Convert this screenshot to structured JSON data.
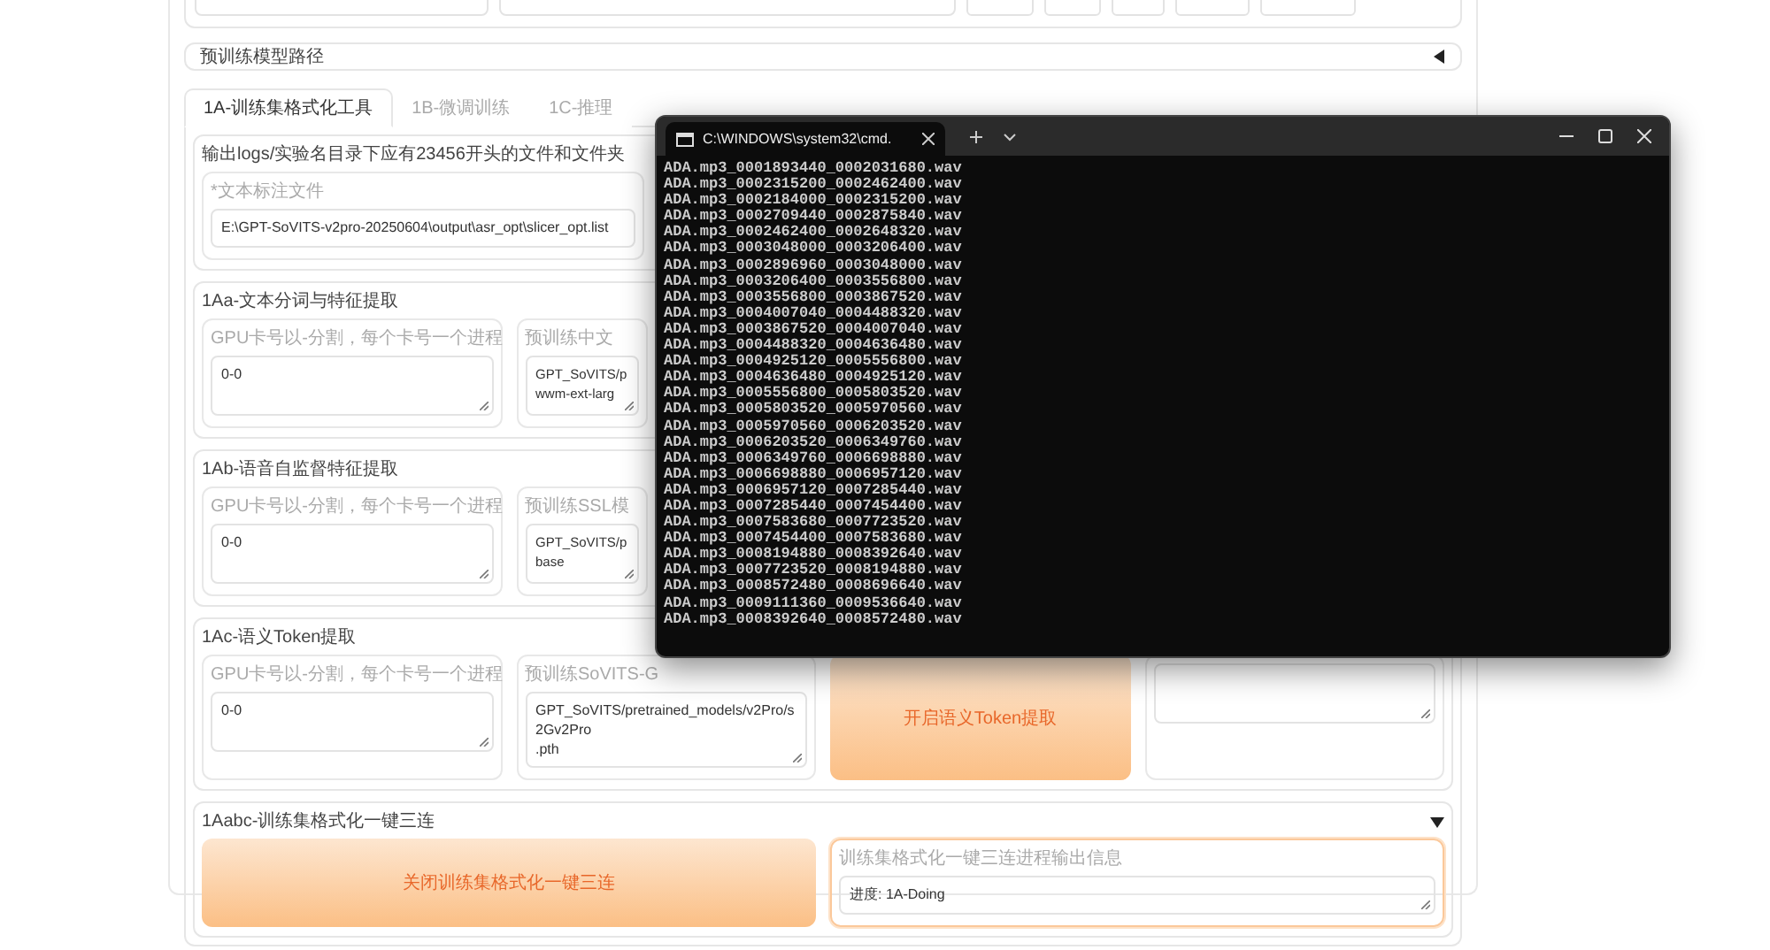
{
  "pretrained_accordion": {
    "label": "预训练模型路径",
    "expanded": false
  },
  "tabs": [
    {
      "label": "1A-训练集格式化工具",
      "selected": true
    },
    {
      "label": "1B-微调训练",
      "selected": false
    },
    {
      "label": "1C-推理",
      "selected": false
    }
  ],
  "intro": {
    "note": "输出logs/实验名目录下应有23456开头的文件和文件夹",
    "field": {
      "label": "*文本标注文件",
      "value": "E:\\GPT-SoVITS-v2pro-20250604\\output\\asr_opt\\slicer_opt.list"
    }
  },
  "sections": [
    {
      "title": "1Aa-文本分词与特征提取",
      "items": [
        {
          "kind": "field",
          "label": "GPU卡号以-分割，每个卡号一个进程",
          "value": "0-0"
        },
        {
          "kind": "field",
          "label": "预训练中文",
          "value": "GPT_SoVITS/p\nwwm-ext-larg"
        }
      ]
    },
    {
      "title": "1Ab-语音自监督特征提取",
      "items": [
        {
          "kind": "field",
          "label": "GPU卡号以-分割，每个卡号一个进程",
          "value": "0-0"
        },
        {
          "kind": "field",
          "label": "预训练SSL模",
          "value": "GPT_SoVITS/p\nbase"
        }
      ]
    },
    {
      "title": "1Ac-语义Token提取",
      "items": [
        {
          "kind": "field",
          "label": "GPU卡号以-分割，每个卡号一个进程",
          "value": "0-0"
        },
        {
          "kind": "field",
          "label": "预训练SoVITS-G",
          "value": "GPT_SoVITS/pretrained_models/v2Pro/s2Gv2Pro\n.pth"
        },
        {
          "kind": "button",
          "label": "开启语义Token提取"
        },
        {
          "kind": "field"
        }
      ]
    }
  ],
  "oneclick": {
    "title": "1Aabc-训练集格式化一键三连",
    "expanded": true,
    "button": "关闭训练集格式化一键三连",
    "output": {
      "label": "训练集格式化一键三连进程输出信息",
      "value": "进度: 1A-Doing"
    }
  },
  "terminal": {
    "tab_title": "C:\\WINDOWS\\system32\\cmd.",
    "lines": [
      "ADA.mp3_0001893440_0002031680.wav",
      "ADA.mp3_0002315200_0002462400.wav",
      "ADA.mp3_0002184000_0002315200.wav",
      "ADA.mp3_0002709440_0002875840.wav",
      "ADA.mp3_0002462400_0002648320.wav",
      "ADA.mp3_0003048000_0003206400.wav",
      "ADA.mp3_0002896960_0003048000.wav",
      "ADA.mp3_0003206400_0003556800.wav",
      "ADA.mp3_0003556800_0003867520.wav",
      "ADA.mp3_0004007040_0004488320.wav",
      "ADA.mp3_0003867520_0004007040.wav",
      "ADA.mp3_0004488320_0004636480.wav",
      "ADA.mp3_0004925120_0005556800.wav",
      "ADA.mp3_0004636480_0004925120.wav",
      "ADA.mp3_0005556800_0005803520.wav",
      "ADA.mp3_0005803520_0005970560.wav",
      "ADA.mp3_0005970560_0006203520.wav",
      "ADA.mp3_0006203520_0006349760.wav",
      "ADA.mp3_0006349760_0006698880.wav",
      "ADA.mp3_0006698880_0006957120.wav",
      "ADA.mp3_0006957120_0007285440.wav",
      "ADA.mp3_0007285440_0007454400.wav",
      "ADA.mp3_0007583680_0007723520.wav",
      "ADA.mp3_0007454400_0007583680.wav",
      "ADA.mp3_0008194880_0008392640.wav",
      "ADA.mp3_0007723520_0008194880.wav",
      "ADA.mp3_0008572480_0008696640.wav",
      "ADA.mp3_0009111360_0009536640.wav",
      "ADA.mp3_0008392640_0008572480.wav"
    ]
  }
}
